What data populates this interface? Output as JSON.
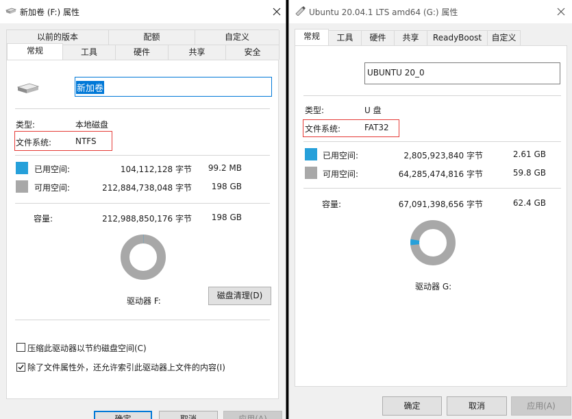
{
  "left_dialog": {
    "title": "新加卷 (F:) 属性",
    "tabs_row1": [
      "以前的版本",
      "配额",
      "自定义"
    ],
    "tabs_row2": [
      "常规",
      "工具",
      "硬件",
      "共享",
      "安全"
    ],
    "active_tab": "常规",
    "volume_label": "新加卷",
    "type_label": "类型:",
    "type_value": "本地磁盘",
    "fs_label": "文件系统:",
    "fs_value": "NTFS",
    "used_label": "已用空间:",
    "used_bytes": "104,112,128 字节",
    "used_size": "99.2 MB",
    "free_label": "可用空间:",
    "free_bytes": "212,884,738,048 字节",
    "free_size": "198 GB",
    "capacity_label": "容量:",
    "capacity_bytes": "212,988,850,176 字节",
    "capacity_size": "198 GB",
    "used_fraction": 0.0005,
    "drive_label": "驱动器 F:",
    "cleanup_button": "磁盘清理(D)",
    "compress_label": "压缩此驱动器以节约磁盘空间(C)",
    "compress_checked": false,
    "index_label": "除了文件属性外，还允许索引此驱动器上文件的内容(I)",
    "index_checked": true,
    "ok_button": "确定",
    "cancel_button": "取消",
    "apply_button": "应用(A)"
  },
  "right_dialog": {
    "title": "Ubuntu 20.04.1 LTS amd64 (G:) 属性",
    "tabs": [
      "常规",
      "工具",
      "硬件",
      "共享",
      "ReadyBoost",
      "自定义"
    ],
    "active_tab": "常规",
    "volume_label": "UBUNTU 20_0",
    "type_label": "类型:",
    "type_value": "U 盘",
    "fs_label": "文件系统:",
    "fs_value": "FAT32",
    "used_label": "已用空间:",
    "used_bytes": "2,805,923,840 字节",
    "used_size": "2.61 GB",
    "free_label": "可用空间:",
    "free_bytes": "64,285,474,816 字节",
    "free_size": "59.8 GB",
    "capacity_label": "容量:",
    "capacity_bytes": "67,091,398,656 字节",
    "capacity_size": "62.4 GB",
    "used_fraction": 0.042,
    "drive_label": "驱动器 G:",
    "ok_button": "确定",
    "cancel_button": "取消",
    "apply_button": "应用(A)"
  },
  "colors": {
    "used": "#26a0da",
    "free": "#a8a8a8",
    "highlight_box": "#e53935",
    "focus_border": "#0078d7"
  },
  "icons": [
    "drive-icon",
    "usb-drive-icon",
    "close-icon",
    "check-icon"
  ]
}
